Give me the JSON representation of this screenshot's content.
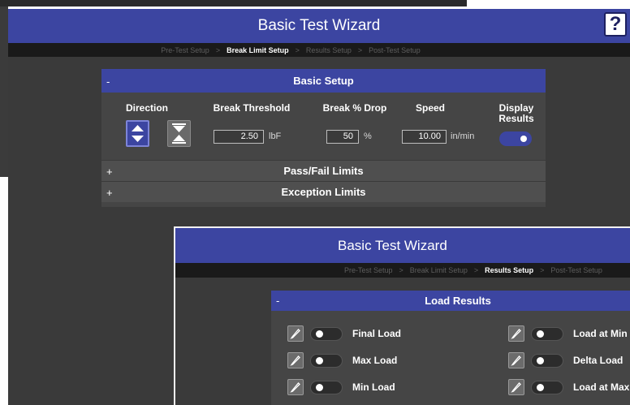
{
  "wizard1": {
    "title": "Basic Test Wizard",
    "help_label": "?",
    "breadcrumbs": [
      "Pre-Test Setup",
      "Break Limit Setup",
      "Results Setup",
      "Post-Test Setup"
    ],
    "separator": ">",
    "current_step": "Break Limit Setup",
    "basic_setup": {
      "header": "Basic Setup",
      "toggle": "-",
      "direction_label": "Direction",
      "break_threshold_label": "Break Threshold",
      "break_threshold_value": "2.50",
      "break_threshold_unit": "lbF",
      "break_drop_label": "Break % Drop",
      "break_drop_value": "50",
      "break_drop_unit": "%",
      "speed_label": "Speed",
      "speed_value": "10.00",
      "speed_unit": "in/min",
      "display_results_label": "Display Results",
      "display_results_on": true
    },
    "collapsed_sections": [
      {
        "toggle": "+",
        "label": "Pass/Fail Limits"
      },
      {
        "toggle": "+",
        "label": "Exception Limits"
      }
    ]
  },
  "wizard2": {
    "title": "Basic Test Wizard",
    "breadcrumbs": [
      "Pre-Test Setup",
      "Break Limit Setup",
      "Results Setup",
      "Post-Test Setup"
    ],
    "separator": ">",
    "current_step": "Results Setup",
    "load_results": {
      "header": "Load Results",
      "toggle": "-",
      "left_items": [
        "Final Load",
        "Max Load",
        "Min Load"
      ],
      "right_items": [
        "Load at Min Extension",
        "Delta Load",
        "Load at Max Extension"
      ]
    }
  },
  "colors": {
    "accent": "#3c45a1",
    "window_bg": "#3a3a3a",
    "panel_bg": "#454545"
  }
}
